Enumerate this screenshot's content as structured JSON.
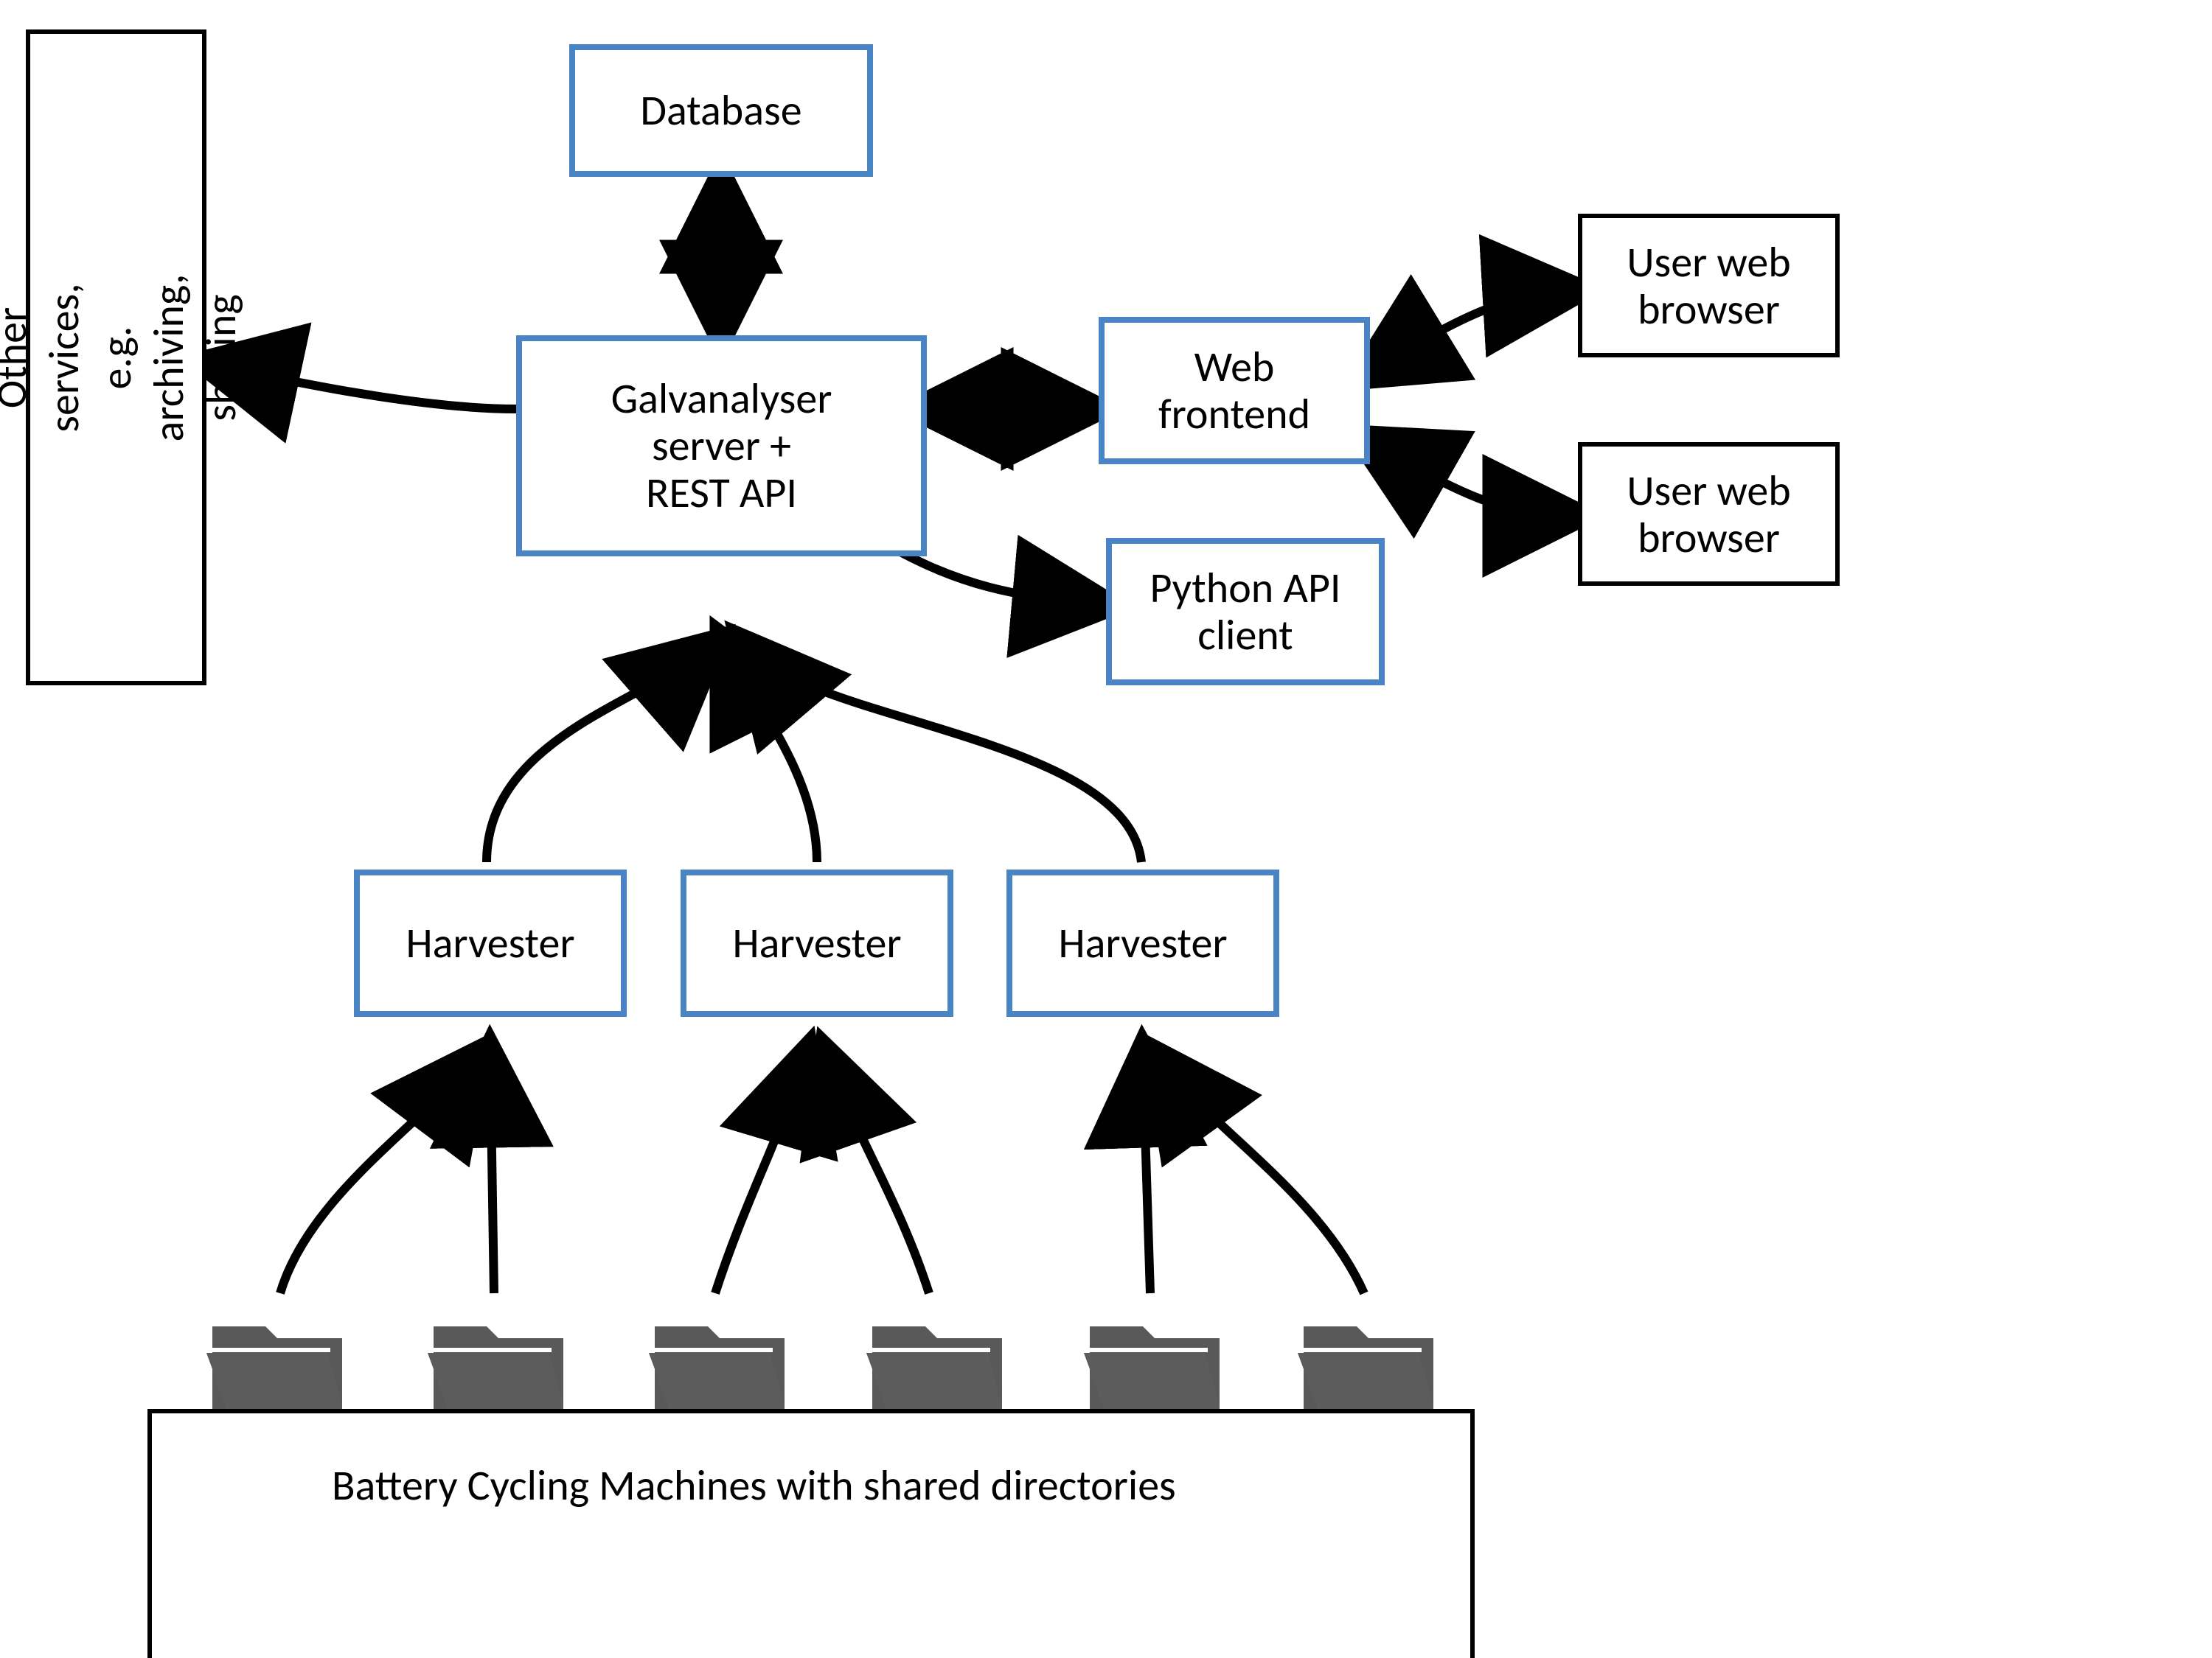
{
  "colors": {
    "blue": "#4984c4",
    "black": "#000000",
    "folder": "#595959"
  },
  "nodes": {
    "database": {
      "label": "Database"
    },
    "server": {
      "label": "Galvanalyser\nserver +\nREST API"
    },
    "web_frontend": {
      "label": "Web\nfrontend"
    },
    "python_client": {
      "label": "Python API\nclient"
    },
    "user_browser_1": {
      "label": "User web\nbrowser"
    },
    "user_browser_2": {
      "label": "User web\nbrowser"
    },
    "harvester_1": {
      "label": "Harvester"
    },
    "harvester_2": {
      "label": "Harvester"
    },
    "harvester_3": {
      "label": "Harvester"
    },
    "other_services": {
      "label": "Other services, e.g. archiving,\nsharing"
    },
    "bottom_caption": {
      "label": "Battery Cycling Machines with shared directories"
    }
  },
  "folders": {
    "count": 6
  },
  "edges": [
    {
      "from": "database",
      "to": "server",
      "direction": "bidirectional"
    },
    {
      "from": "server",
      "to": "web_frontend",
      "direction": "bidirectional"
    },
    {
      "from": "web_frontend",
      "to": "user_browser_1",
      "direction": "bidirectional"
    },
    {
      "from": "web_frontend",
      "to": "user_browser_2",
      "direction": "bidirectional"
    },
    {
      "from": "server",
      "to": "python_client",
      "direction": "forward"
    },
    {
      "from": "server",
      "to": "other_services",
      "direction": "forward"
    },
    {
      "from": "harvester_1",
      "to": "server",
      "direction": "forward"
    },
    {
      "from": "harvester_2",
      "to": "server",
      "direction": "forward"
    },
    {
      "from": "harvester_3",
      "to": "server",
      "direction": "forward"
    },
    {
      "from": "folder_1",
      "to": "harvester_1",
      "direction": "forward"
    },
    {
      "from": "folder_2",
      "to": "harvester_1",
      "direction": "forward"
    },
    {
      "from": "folder_3",
      "to": "harvester_2",
      "direction": "forward"
    },
    {
      "from": "folder_4",
      "to": "harvester_2",
      "direction": "forward"
    },
    {
      "from": "folder_5",
      "to": "harvester_3",
      "direction": "forward"
    },
    {
      "from": "folder_6",
      "to": "harvester_3",
      "direction": "forward"
    }
  ]
}
